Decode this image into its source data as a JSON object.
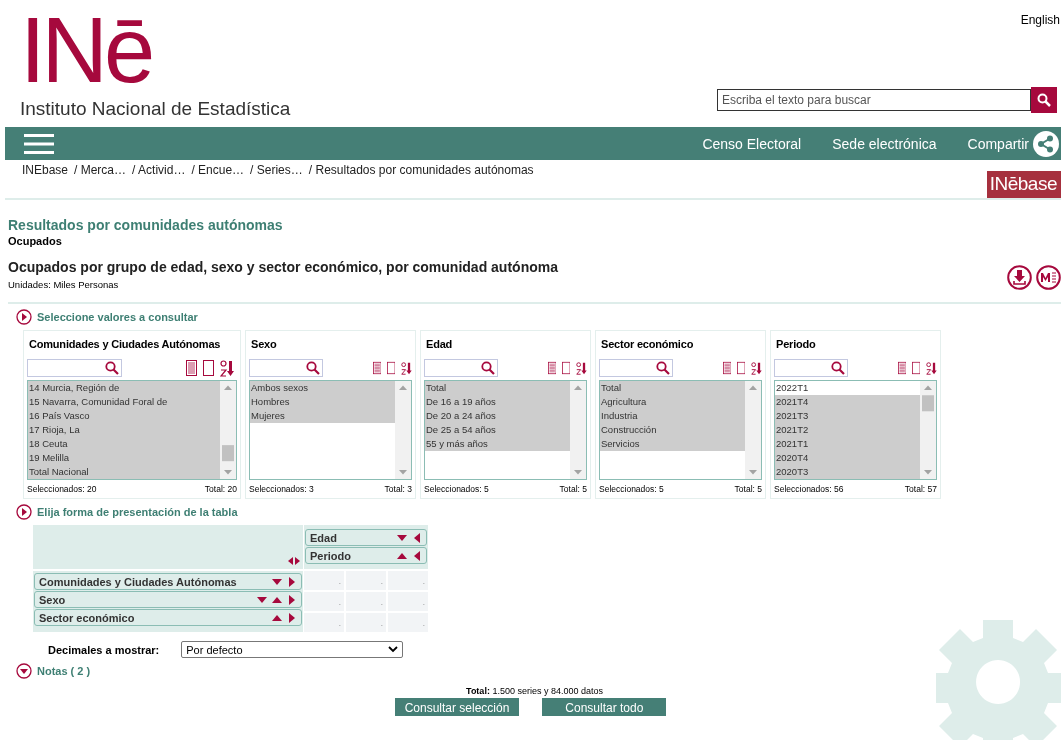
{
  "header": {
    "language": "English",
    "logo": "INē",
    "institute": "Instituto Nacional de Estadística",
    "search": {
      "placeholder": "Escriba el texto para buscar"
    }
  },
  "nav": {
    "items": [
      "Censo Electoral",
      "Sede electrónica",
      "Compartir"
    ]
  },
  "breadcrumb": [
    "INEbase",
    "/ Merca…",
    "/ Activid…",
    "/ Encue…",
    "/ Series…",
    "/ Resultados por comunidades autónomas"
  ],
  "badge": "INēbase",
  "page": {
    "title": "Resultados por comunidades autónomas",
    "subtitle": "Ocupados",
    "table_title": "Ocupados por grupo de edad, sexo y sector económico, por comunidad autónoma",
    "units": "Unidades: Miles Personas"
  },
  "select_section": {
    "label": "Seleccione valores a consultar",
    "kind": "right"
  },
  "variables": [
    {
      "title": "Comunidades y Ciudades Autónomas",
      "selected_count": "Seleccionados: 20",
      "total": "Total: 20",
      "items": [
        {
          "label": "14 Murcia, Región de",
          "selected": true
        },
        {
          "label": "15 Navarra, Comunidad Foral de",
          "selected": true
        },
        {
          "label": "16 País Vasco",
          "selected": true
        },
        {
          "label": "17 Rioja, La",
          "selected": true
        },
        {
          "label": "18 Ceuta",
          "selected": true
        },
        {
          "label": "19 Melilla",
          "selected": true
        },
        {
          "label": "Total Nacional",
          "selected": true
        }
      ]
    },
    {
      "title": "Sexo",
      "selected_count": "Seleccionados: 3",
      "total": "Total: 3",
      "items": [
        {
          "label": "Ambos sexos",
          "selected": true
        },
        {
          "label": "Hombres",
          "selected": true
        },
        {
          "label": "Mujeres",
          "selected": true
        }
      ]
    },
    {
      "title": "Edad",
      "selected_count": "Seleccionados: 5",
      "total": "Total: 5",
      "items": [
        {
          "label": "Total",
          "selected": true
        },
        {
          "label": "De 16 a 19 años",
          "selected": true
        },
        {
          "label": "De 20 a 24 años",
          "selected": true
        },
        {
          "label": "De 25 a 54 años",
          "selected": true
        },
        {
          "label": "55 y más años",
          "selected": true
        }
      ]
    },
    {
      "title": "Sector económico",
      "selected_count": "Seleccionados: 5",
      "total": "Total: 5",
      "items": [
        {
          "label": "Total",
          "selected": true
        },
        {
          "label": "Agricultura",
          "selected": true
        },
        {
          "label": "Industria",
          "selected": true
        },
        {
          "label": "Construcción",
          "selected": true
        },
        {
          "label": "Servicios",
          "selected": true
        }
      ]
    },
    {
      "title": "Periodo",
      "selected_count": "Seleccionados: 56",
      "total": "Total: 57",
      "items": [
        {
          "label": "2022T1",
          "selected": false
        },
        {
          "label": "2021T4",
          "selected": true
        },
        {
          "label": "2021T3",
          "selected": true
        },
        {
          "label": "2021T2",
          "selected": true
        },
        {
          "label": "2021T1",
          "selected": true
        },
        {
          "label": "2020T4",
          "selected": true
        },
        {
          "label": "2020T3",
          "selected": true
        }
      ]
    }
  ],
  "layout_section": {
    "label": "Elija forma de presentación de la tabla",
    "kind": "right",
    "columns": [
      {
        "label": "Edad",
        "arrows": [
          {
            "kind": "down"
          },
          {
            "kind": "left"
          }
        ]
      },
      {
        "label": "Periodo",
        "arrows": [
          {
            "kind": "up"
          },
          {
            "kind": "left"
          }
        ]
      }
    ],
    "rows": [
      {
        "label": "Comunidades y Ciudades Autónomas",
        "arrows": [
          {
            "kind": "down"
          },
          {
            "kind": "right"
          }
        ]
      },
      {
        "label": "Sexo",
        "arrows": [
          {
            "kind": "down"
          },
          {
            "kind": "up"
          },
          {
            "kind": "right"
          }
        ]
      },
      {
        "label": "Sector económico",
        "arrows": [
          {
            "kind": "up"
          },
          {
            "kind": "right"
          }
        ]
      }
    ],
    "cells": [
      [
        ".",
        ".",
        "."
      ],
      [
        ".",
        ".",
        "."
      ],
      [
        ".",
        ".",
        "."
      ]
    ]
  },
  "decimals": {
    "label": "Decimales a mostrar:",
    "value": "Por defecto"
  },
  "notes_section": {
    "label": "Notas ( 2 )",
    "kind": "down"
  },
  "summary": "**Total:** 1.500 series y  84.000 datos",
  "buttons": [
    "Consultar selección",
    "Consultar todo"
  ]
}
